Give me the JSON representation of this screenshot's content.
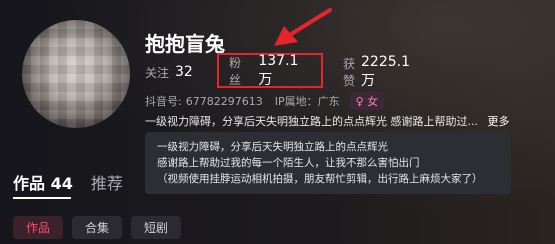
{
  "profile": {
    "nickname": "抱抱盲兔",
    "following_label": "关注",
    "following_value": "32",
    "followers_label": "粉丝",
    "followers_value": "137.1万",
    "likes_label": "获赞",
    "likes_value": "2225.1万",
    "douyin_id_label": "抖音号:",
    "douyin_id": "67782297613",
    "ip_location": "IP属地：广东",
    "gender_symbol": "♀",
    "gender_label": "女",
    "bio_preview": "一级视力障碍，分享后天失明独立路上的点点辉光 感谢路上帮助过...",
    "more_label": "更多"
  },
  "bio_popover": {
    "line1": "一级视力障碍，分享后天失明独立路上的点点辉光",
    "line2": "感谢路上帮助过我的每一个陌生人，让我不那么害怕出门",
    "line3": "（视频使用挂脖运动相机拍摄，朋友帮忙剪辑，出行路上麻烦大家了）"
  },
  "tabs": {
    "works": "作品 44",
    "recommend": "推荐"
  },
  "chips": [
    {
      "label": "作品"
    },
    {
      "label": "合集"
    },
    {
      "label": "短剧"
    }
  ],
  "colors": {
    "highlight_box": "#e5242c",
    "accent_pink": "#ff4a6a",
    "background": "#121218"
  }
}
